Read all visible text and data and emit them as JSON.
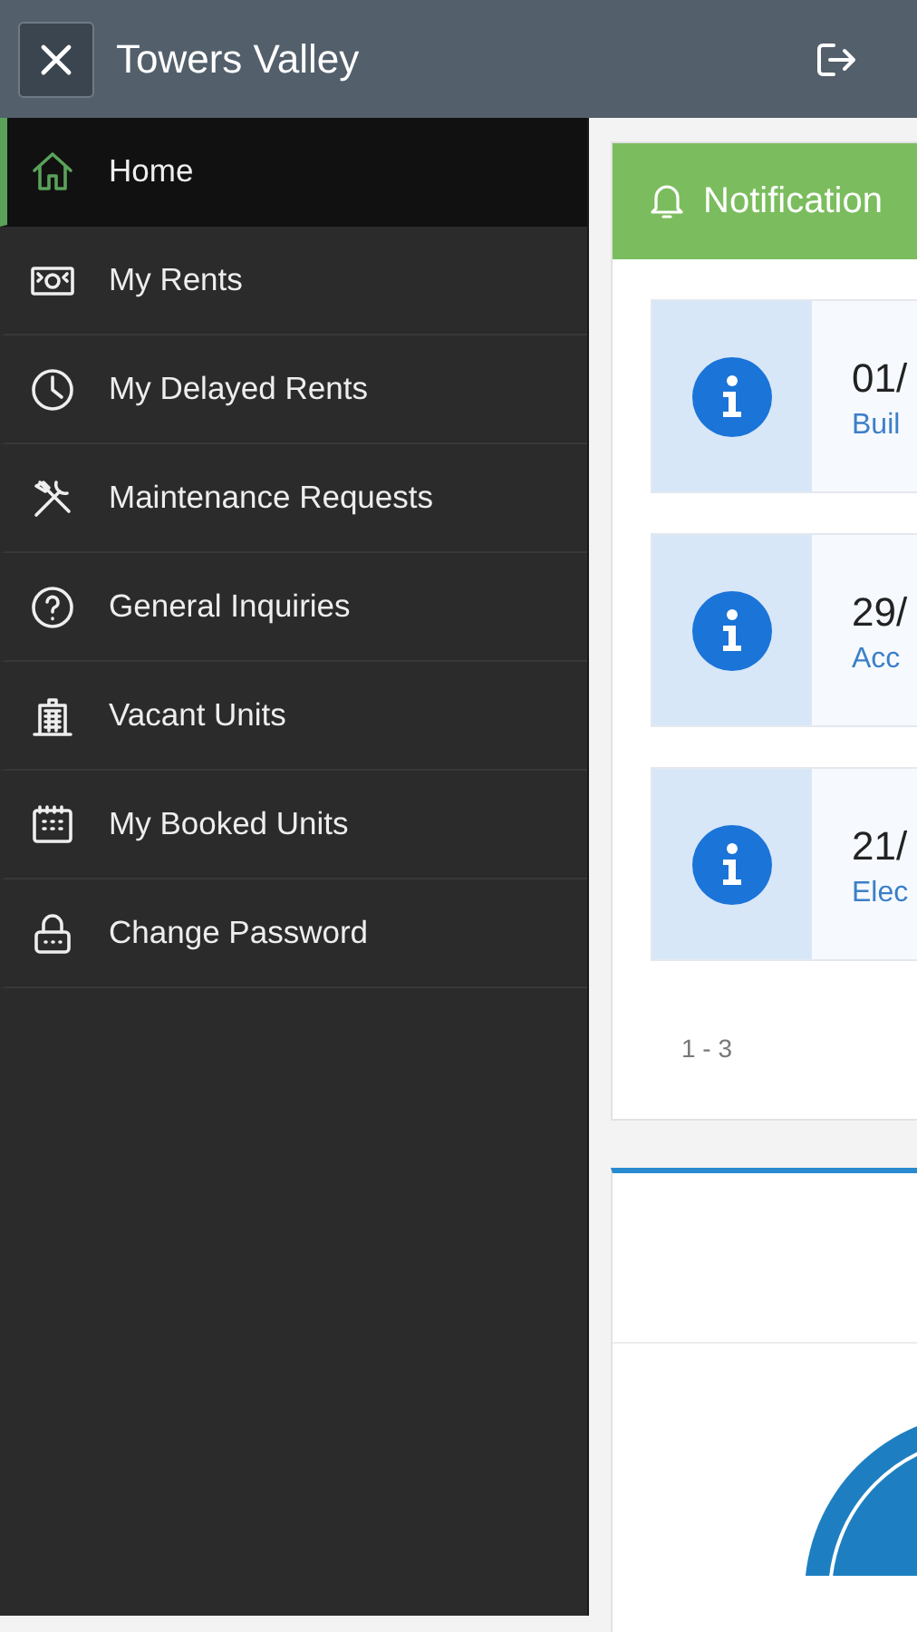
{
  "header": {
    "title": "Towers Valley"
  },
  "sidebar": {
    "items": [
      {
        "label": "Home",
        "selected": true
      },
      {
        "label": "My Rents",
        "selected": false
      },
      {
        "label": "My Delayed Rents",
        "selected": false
      },
      {
        "label": "Maintenance Requests",
        "selected": false
      },
      {
        "label": "General Inquiries",
        "selected": false
      },
      {
        "label": "Vacant Units",
        "selected": false
      },
      {
        "label": "My Booked Units",
        "selected": false
      },
      {
        "label": "Change Password",
        "selected": false
      }
    ]
  },
  "notifications": {
    "title": "Notification",
    "items": [
      {
        "date": "01/",
        "text": "Buil"
      },
      {
        "date": "29/",
        "text": "Acc"
      },
      {
        "date": "21/",
        "text": "Elec"
      }
    ],
    "pagination": "1 - 3"
  }
}
